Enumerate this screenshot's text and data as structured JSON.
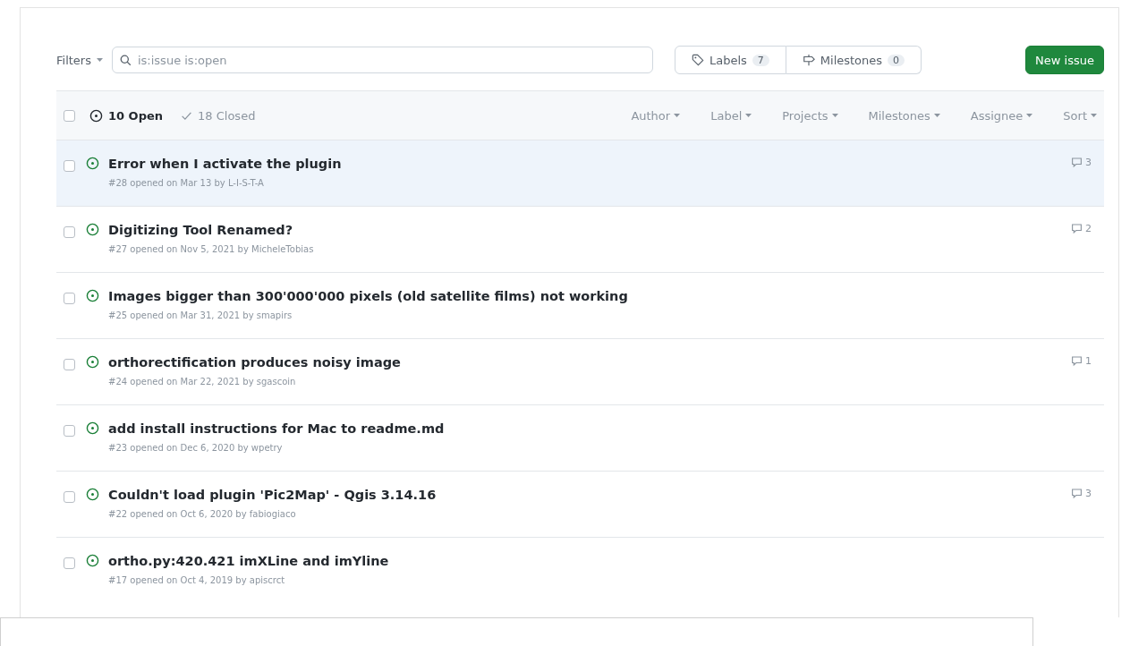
{
  "toolbar": {
    "filters_label": "Filters",
    "search_value": "is:issue is:open",
    "labels": {
      "label": "Labels",
      "count": "7"
    },
    "milestones": {
      "label": "Milestones",
      "count": "0"
    },
    "new_issue": "New issue"
  },
  "header": {
    "checked": false,
    "open": {
      "label": "10 Open",
      "selected": true
    },
    "closed": {
      "label": "18 Closed",
      "selected": false
    },
    "filters": [
      "Author",
      "Label",
      "Projects",
      "Milestones",
      "Assignee",
      "Sort"
    ]
  },
  "issues": [
    {
      "title": "Error when I activate the plugin",
      "meta": "#28 opened on Mar 13 by L-I-S-T-A",
      "comments": "3",
      "checked": false,
      "highlighted": true
    },
    {
      "title": "Digitizing Tool Renamed?",
      "meta": "#27 opened on Nov 5, 2021 by MicheleTobias",
      "comments": "2",
      "checked": false,
      "highlighted": false
    },
    {
      "title": "Images bigger than 300'000'000 pixels (old satellite films) not working",
      "meta": "#25 opened on Mar 31, 2021 by smapirs",
      "checked": false,
      "highlighted": false
    },
    {
      "title": "orthorectification produces noisy image",
      "meta": "#24 opened on Mar 22, 2021 by sgascoin",
      "comments": "1",
      "checked": false,
      "highlighted": false
    },
    {
      "title": "add install instructions for Mac to readme.md",
      "meta": "#23 opened on Dec 6, 2020 by wpetry",
      "checked": false,
      "highlighted": false
    },
    {
      "title": "Couldn't load plugin 'Pic2Map' - Qgis 3.14.16",
      "meta": "#22 opened on Oct 6, 2020 by fabiogiaco",
      "comments": "3",
      "checked": false,
      "highlighted": false
    },
    {
      "title": "ortho.py:420.421 imXLine and imYline",
      "meta": "#17 opened on Oct 4, 2019 by apiscrct",
      "checked": false,
      "highlighted": false
    }
  ]
}
